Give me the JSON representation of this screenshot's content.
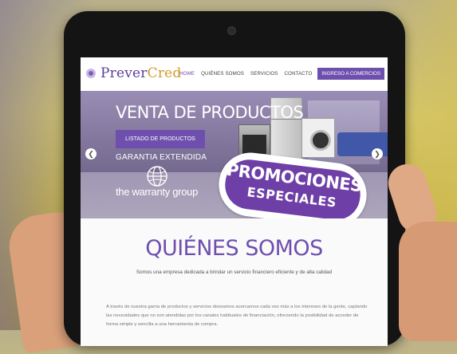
{
  "brand": {
    "name_part1": "Prever",
    "name_part2": "Cred"
  },
  "nav": {
    "items": [
      "HOME",
      "QUIÉNES SOMOS",
      "SERVICIOS",
      "CONTACTO"
    ],
    "cta": "INGRESO A COMERCIOS"
  },
  "hero": {
    "title": "VENTA DE PRODUCTOS",
    "button": "LISTADO DE PRODUCTOS",
    "subtitle": "GARANTIA EXTENDIDA",
    "partner": "the warranty group",
    "prev_icon": "chevron-left-icon",
    "next_icon": "chevron-right-icon"
  },
  "promo": {
    "line1": "PROMOCIONES",
    "line2": "ESPECIALES"
  },
  "about": {
    "title": "QUIÉNES SOMOS",
    "subtitle": "Somos una empresa dedicada a brindar un servicio financiero eficiente y de alta calidad",
    "body": "A través de nuestra gama de productos y servicios deseamos acercarnos cada vez más a los intereses de la gente, captando las necesidades que no son atendidas por los canales habituales de financiación, ofreciendo la posibilidad de acceder de forma simple y sencilla a una herramienta de compra."
  },
  "colors": {
    "brand_purple": "#6e4fae",
    "brand_gold": "#d39a2a"
  }
}
